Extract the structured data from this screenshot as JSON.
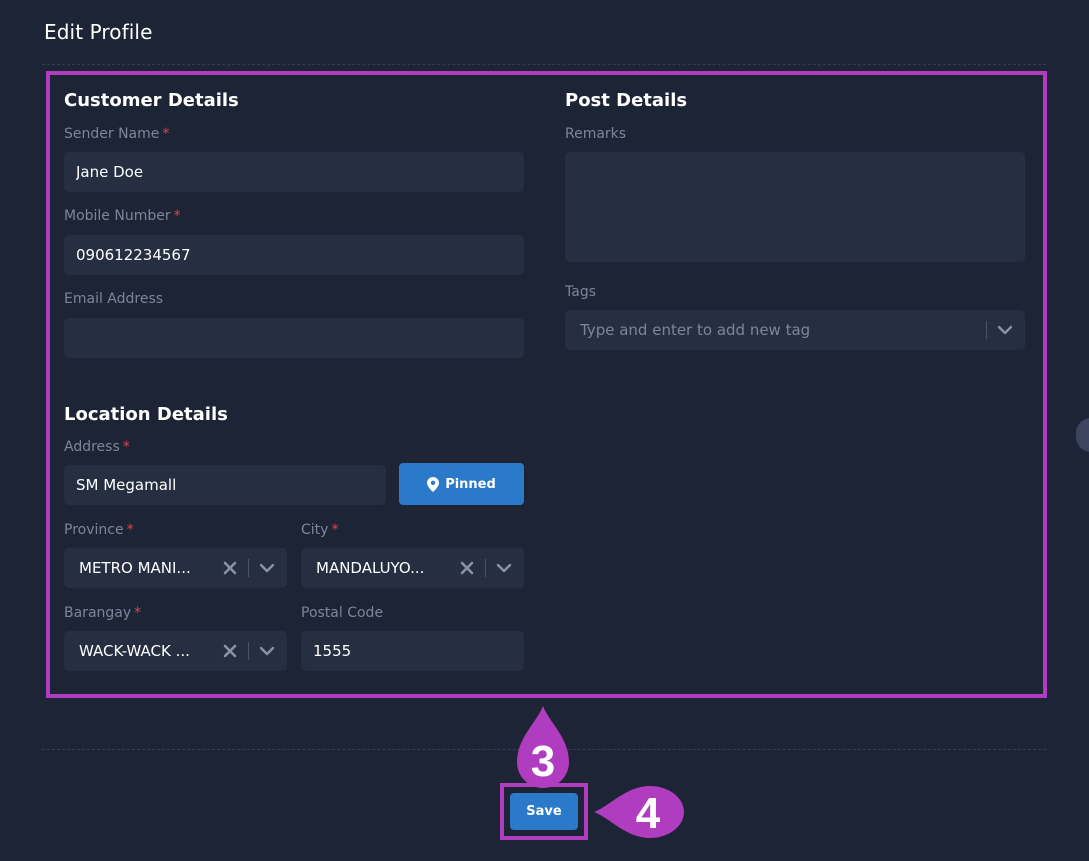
{
  "page": {
    "title": "Edit Profile",
    "save_label": "Save"
  },
  "customer": {
    "title": "Customer Details",
    "sender_name": {
      "label": "Sender Name",
      "required": "*",
      "value": "Jane Doe"
    },
    "mobile": {
      "label": "Mobile Number",
      "required": "*",
      "value": "090612234567"
    },
    "email": {
      "label": "Email Address",
      "value": ""
    }
  },
  "post": {
    "title": "Post Details",
    "remarks": {
      "label": "Remarks",
      "value": ""
    },
    "tags": {
      "label": "Tags",
      "placeholder": "Type and enter to add new tag"
    }
  },
  "location": {
    "title": "Location Details",
    "address": {
      "label": "Address",
      "required": "*",
      "value": "SM Megamall"
    },
    "pinned_label": "Pinned",
    "province": {
      "label": "Province",
      "required": "*",
      "value": "METRO MANI..."
    },
    "city": {
      "label": "City",
      "required": "*",
      "value": "MANDALUYO..."
    },
    "barangay": {
      "label": "Barangay",
      "required": "*",
      "value": "WACK-WACK ..."
    },
    "postal": {
      "label": "Postal Code",
      "value": "1555"
    }
  },
  "callouts": {
    "step3": "3",
    "step4": "4"
  },
  "colors": {
    "background": "#1c2436",
    "field": "#262f42",
    "primary": "#2b79c9",
    "highlight": "#b03cbf",
    "required": "#e0454f",
    "muted_text": "#7c869a"
  },
  "icons": {
    "pin": "map-pin-icon",
    "clear": "close-icon",
    "dropdown": "chevron-down-icon"
  }
}
